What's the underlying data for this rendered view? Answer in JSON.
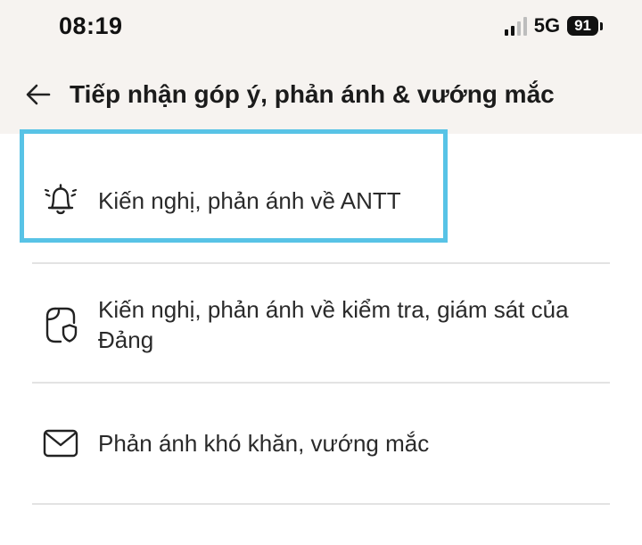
{
  "status_bar": {
    "time": "08:19",
    "network": "5G",
    "battery": "91"
  },
  "header": {
    "title": "Tiếp nhận góp ý, phản ánh & vướng mắc"
  },
  "items": [
    {
      "label": "Kiến nghị, phản ánh về ANTT",
      "icon": "bell-alert-icon"
    },
    {
      "label": "Kiến nghị, phản ánh về kiểm tra, giám sát của Đảng",
      "icon": "shield-document-icon"
    },
    {
      "label": "Phản ánh khó khăn, vướng mắc",
      "icon": "envelope-icon"
    }
  ],
  "colors": {
    "highlight": "#58c3e6",
    "header_bg": "#f6f3f0"
  }
}
